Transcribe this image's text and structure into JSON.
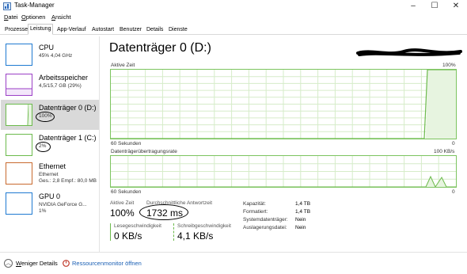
{
  "window": {
    "title": "Task-Manager"
  },
  "window_controls": {
    "minimize": "–",
    "maximize": "☐",
    "close": "✕"
  },
  "menu": [
    {
      "label_pre": "",
      "accel": "D",
      "label_post": "atei"
    },
    {
      "label_pre": "",
      "accel": "O",
      "label_post": "ptionen"
    },
    {
      "label_pre": "",
      "accel": "A",
      "label_post": "nsicht"
    }
  ],
  "tabs": [
    "Prozesse",
    "Leistung",
    "App-Verlauf",
    "Autostart",
    "Benutzer",
    "Details",
    "Dienste"
  ],
  "active_tab": "Leistung",
  "sidebar": {
    "items": [
      {
        "title": "CPU",
        "sub": "45% 4,04 GHz",
        "color": "#1f7ad1"
      },
      {
        "title": "Arbeitsspeicher",
        "sub": "4,5/15,7 GB (29%)",
        "color": "#9b3fc6"
      },
      {
        "title": "Datenträger 0 (D:)",
        "sub": "100%",
        "color": "#6cba4c"
      },
      {
        "title": "Datenträger 1 (C:)",
        "sub": "2%",
        "color": "#6cba4c"
      },
      {
        "title": "Ethernet",
        "sub": "Ethernet",
        "sub2": "Ges.: 2,8  Empf.: 80,0 MB",
        "color": "#c8692e"
      },
      {
        "title": "GPU 0",
        "sub": "NVIDIA GeForce G...",
        "sub2": "1%",
        "color": "#1f7ad1"
      }
    ]
  },
  "main": {
    "title": "Datenträger 0 (D:)",
    "graph1": {
      "label": "Aktive Zeit",
      "max": "100%",
      "time": "60 Sekunden",
      "min": "0",
      "level_pct": 100
    },
    "graph2": {
      "label": "Datenträgerübertragungsrate",
      "max": "100 KB/s",
      "time": "60 Sekunden",
      "min": "0"
    }
  },
  "stats": {
    "active_label": "Aktive Zeit",
    "active_value": "100%",
    "response_label": "Durchschnittliche Antwortzeit",
    "response_value": "1732 ms",
    "read_label": "Lesegeschwindigkeit",
    "read_value": "0 KB/s",
    "write_label": "Schreibgeschwindigkeit",
    "write_value": "4,1 KB/s"
  },
  "properties": [
    {
      "key": "Kapazität:",
      "value": "1,4 TB"
    },
    {
      "key": "Formatiert:",
      "value": "1,4 TB"
    },
    {
      "key": "Systemdatenträger:",
      "value": "Nein"
    },
    {
      "key": "Auslagerungsdatei:",
      "value": "Nein"
    }
  ],
  "footer": {
    "less_details_pre": "",
    "less_details_accel": "W",
    "less_details_post": "eniger Details",
    "resource_monitor": "Ressourcenmonitor öffnen"
  },
  "colors": {
    "accent_disk": "#6cba4c",
    "link": "#1a5fb4"
  }
}
